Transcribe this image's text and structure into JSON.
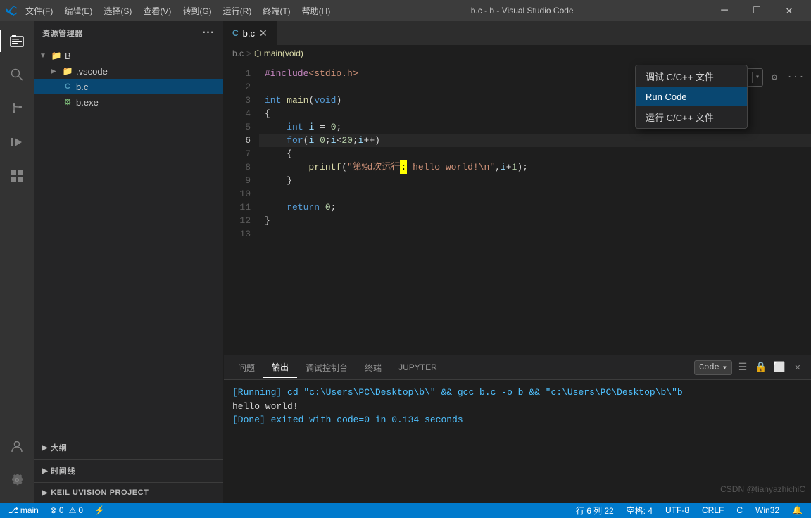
{
  "titlebar": {
    "title": "b.c - b - Visual Studio Code",
    "menu": [
      "文件(F)",
      "编辑(E)",
      "选择(S)",
      "查看(V)",
      "转到(G)",
      "运行(R)",
      "终端(T)",
      "帮助(H)"
    ]
  },
  "sidebar": {
    "header": "资源管理器",
    "root_folder": "B",
    "items": [
      {
        "name": ".vscode",
        "type": "folder",
        "indent": 1
      },
      {
        "name": "b.c",
        "type": "c-file",
        "indent": 1,
        "active": true
      },
      {
        "name": "b.exe",
        "type": "exe-file",
        "indent": 1
      }
    ],
    "sections": [
      {
        "label": "大纲"
      },
      {
        "label": "时间线"
      },
      {
        "label": "KEIL UVISION PROJECT"
      }
    ]
  },
  "tabs": [
    {
      "label": "b.c",
      "active": true,
      "icon": "C"
    }
  ],
  "breadcrumb": {
    "file": "b.c",
    "sep": ">",
    "symbol": "main(void)"
  },
  "code": {
    "lines": [
      {
        "num": 1,
        "content": "#include<stdio.h>"
      },
      {
        "num": 2,
        "content": ""
      },
      {
        "num": 3,
        "content": "int main(void)"
      },
      {
        "num": 4,
        "content": "{"
      },
      {
        "num": 5,
        "content": "    int i = 0;"
      },
      {
        "num": 6,
        "content": "    for(i=0;i<20;i++)",
        "active": true
      },
      {
        "num": 7,
        "content": "    {"
      },
      {
        "num": 8,
        "content": "        printf(\"第%d次运行: hello world!\\n\",i+1);"
      },
      {
        "num": 9,
        "content": "    }"
      },
      {
        "num": 10,
        "content": ""
      },
      {
        "num": 11,
        "content": "    return 0;"
      },
      {
        "num": 12,
        "content": "}"
      },
      {
        "num": 13,
        "content": ""
      }
    ]
  },
  "context_menu": {
    "items": [
      {
        "label": "调试 C/C++ 文件",
        "active": false
      },
      {
        "label": "Run Code",
        "active": true
      },
      {
        "label": "运行 C/C++ 文件",
        "active": false
      }
    ]
  },
  "panel": {
    "tabs": [
      "问题",
      "输出",
      "调试控制台",
      "终端",
      "JUPYTER"
    ],
    "active_tab": "输出",
    "dropdown_value": "Code",
    "terminal": {
      "line1": "[Running] cd \"c:\\Users\\PC\\Desktop\\b\\\" && gcc b.c -o b && \"c:\\Users\\PC\\Desktop\\b\\\"b",
      "line2": "hello world!",
      "line3": "[Done] exited with code=0 in 0.134 seconds"
    }
  },
  "status_bar": {
    "errors": "0",
    "warnings": "0",
    "row": "行 6",
    "col": "列 22",
    "spaces": "空格: 4",
    "encoding": "UTF-8",
    "line_ending": "CRLF",
    "lang": "C",
    "platform": "Win32"
  },
  "watermark": "CSDN @tianyazhichiC",
  "toolbar": {
    "run_icon": "▶",
    "dropdown_arrow": "▾",
    "settings_icon": "⚙",
    "more_icon": "···"
  }
}
